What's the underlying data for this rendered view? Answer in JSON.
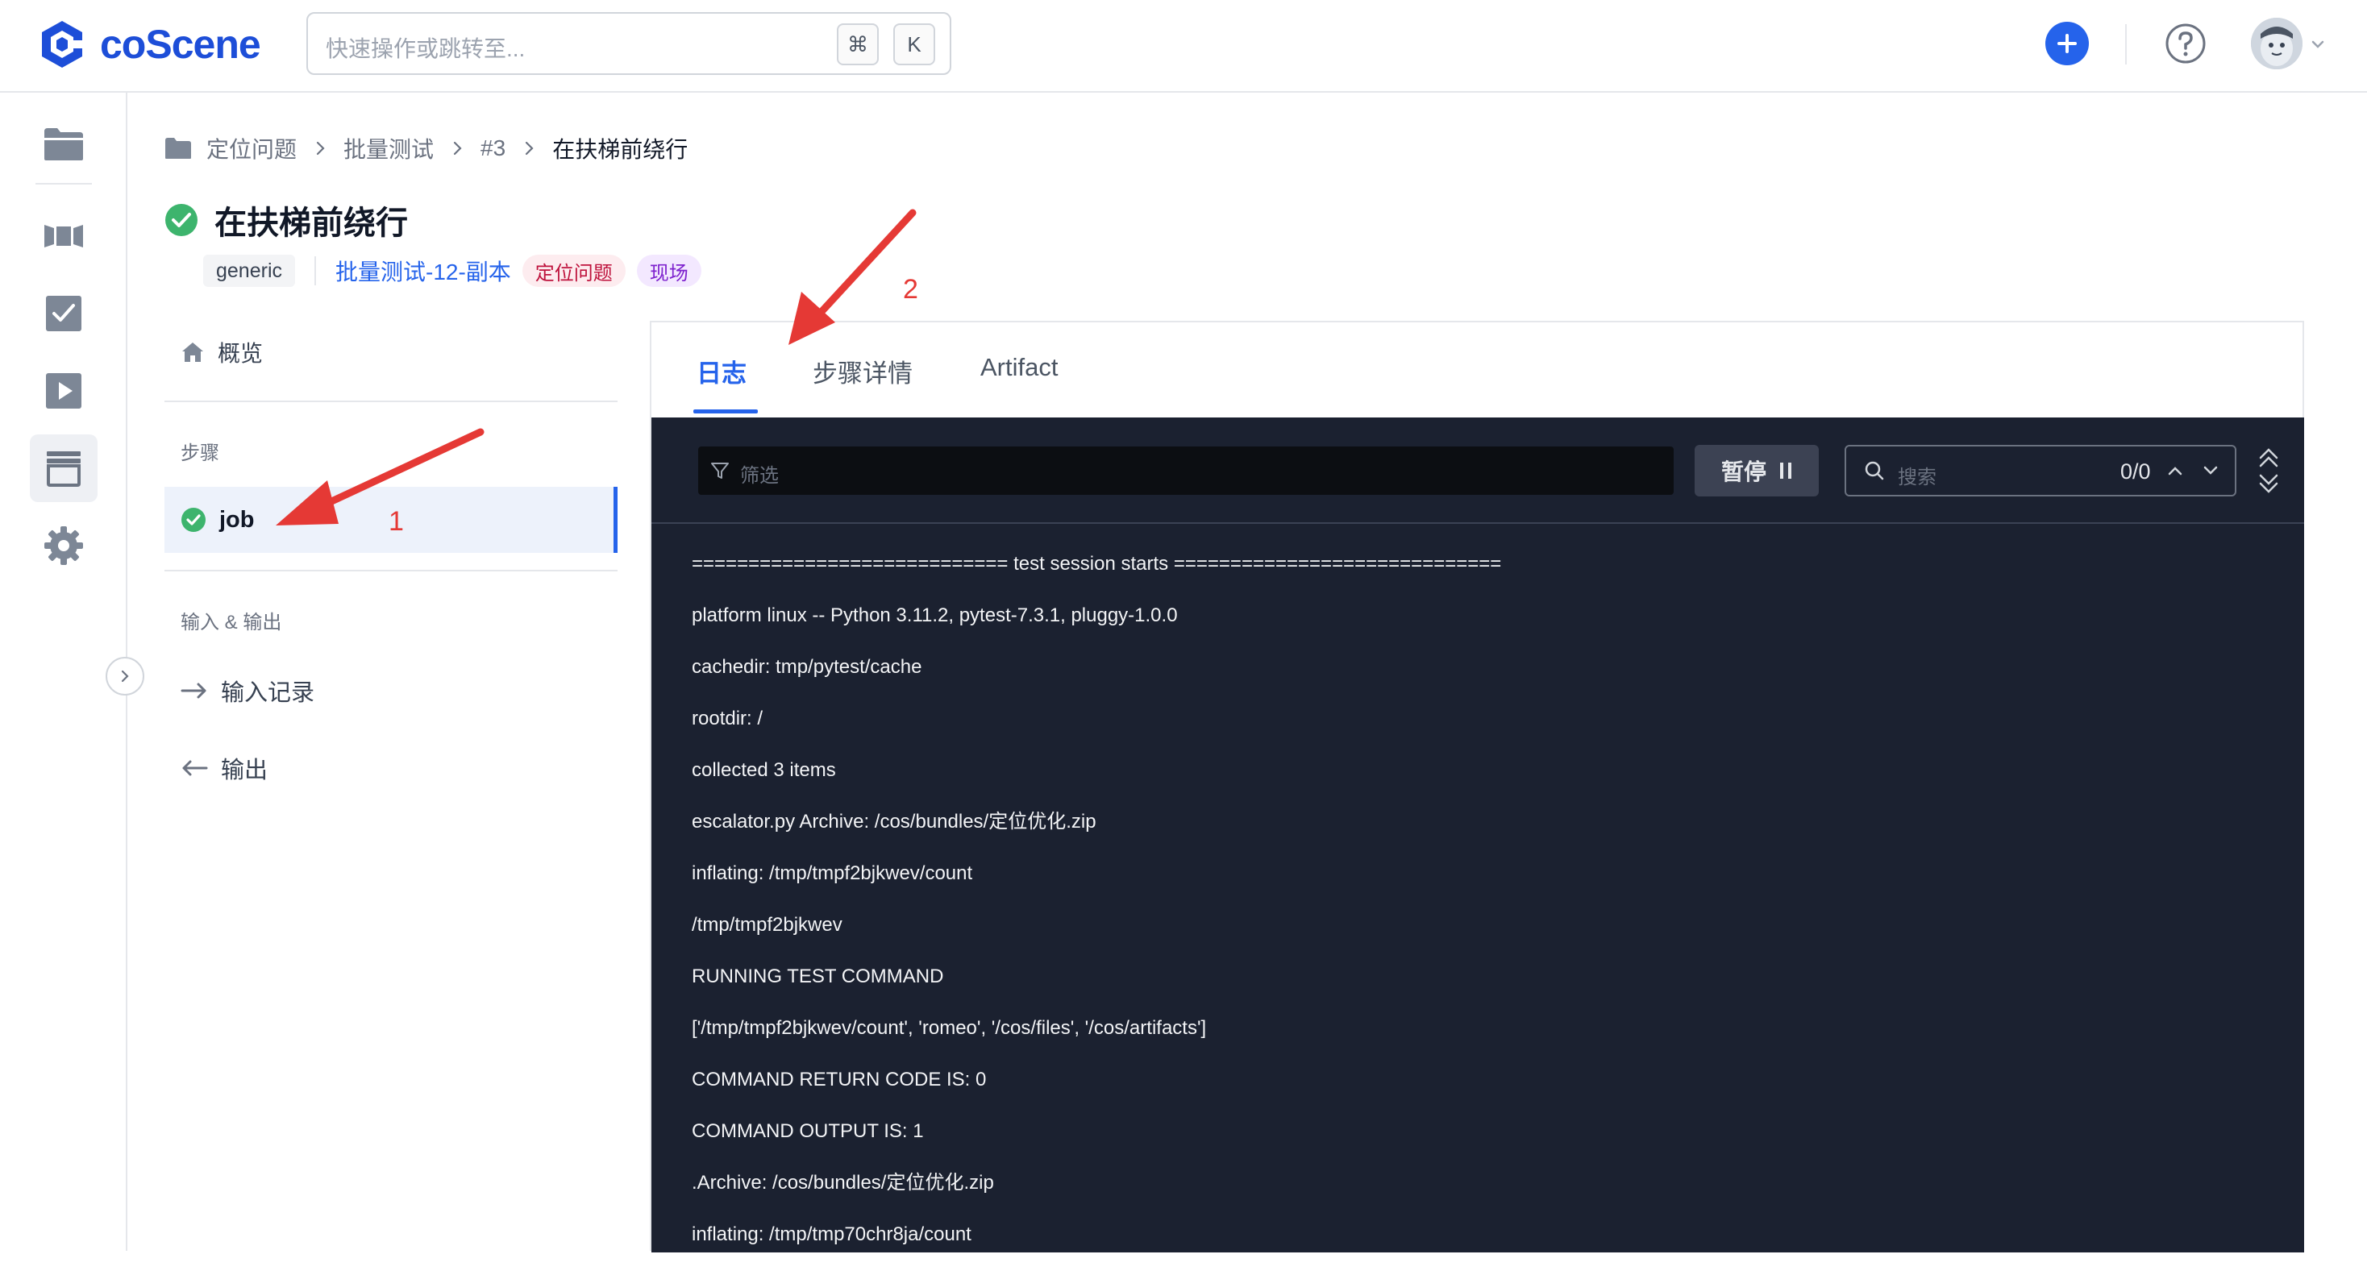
{
  "app": {
    "logo_text": "coScene",
    "search_placeholder": "快速操作或跳转至...",
    "shortcut_cmd": "⌘",
    "shortcut_key": "K",
    "accent_color": "#2563eb"
  },
  "breadcrumb": [
    "定位问题",
    "批量测试",
    "#3",
    "在扶梯前绕行"
  ],
  "title": "在扶梯前绕行",
  "tags": {
    "generic": "generic",
    "link": "批量测试-12-副本",
    "red": "定位问题",
    "purple": "现场"
  },
  "sidebar": {
    "overview": "概览",
    "steps_heading": "步骤",
    "job": "job",
    "io_heading": "输入 & 输出",
    "input_records": "输入记录",
    "output": "输出"
  },
  "tabs": [
    "日志",
    "步骤详情",
    "Artifact"
  ],
  "console": {
    "filter_placeholder": "筛选",
    "pause_label": "暂停",
    "search_placeholder": "搜索",
    "match_count": "0/0",
    "lines": [
      "============================ test session starts =============================",
      "platform linux -- Python 3.11.2, pytest-7.3.1, pluggy-1.0.0",
      "cachedir: tmp/pytest/cache",
      "rootdir: /",
      "collected 3 items",
      "escalator.py Archive: /cos/bundles/定位优化.zip",
      "inflating: /tmp/tmpf2bjkwev/count",
      "/tmp/tmpf2bjkwev",
      "RUNNING TEST COMMAND",
      "['/tmp/tmpf2bjkwev/count', 'romeo', '/cos/files', '/cos/artifacts']",
      "COMMAND RETURN CODE IS: 0",
      "COMMAND OUTPUT IS: 1",
      ".Archive: /cos/bundles/定位优化.zip",
      "inflating: /tmp/tmp70chr8ja/count"
    ]
  },
  "annotations": {
    "label_1": "1",
    "label_2": "2",
    "color": "#e53935"
  }
}
